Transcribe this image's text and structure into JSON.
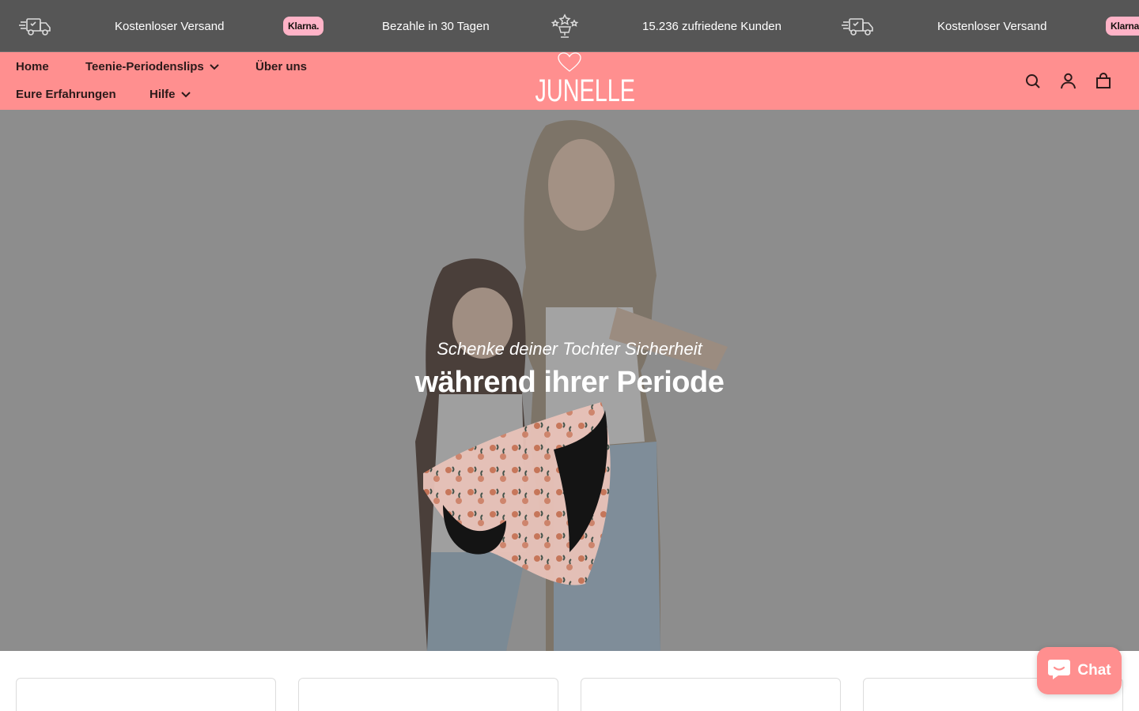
{
  "announcement": {
    "items": [
      {
        "icon": "truck-icon",
        "text": "Kostenloser Versand"
      },
      {
        "icon": "klarna-logo",
        "text": "Bezahle in 30 Tagen"
      },
      {
        "icon": "trophy-icon",
        "text": "15.236 zufriedene Kunden"
      },
      {
        "icon": "truck-icon",
        "text": "Kostenloser Versand"
      },
      {
        "icon": "klarna-logo"
      }
    ],
    "klarna_label": "Klarna.",
    "background": "#565656"
  },
  "header": {
    "background": "#ff8f8f",
    "logo_text": "JUNELLE",
    "nav": {
      "home": "Home",
      "teenie": "Teenie-Periodenslips",
      "about": "Über uns",
      "reviews": "Eure Erfahrungen",
      "help": "Hilfe"
    },
    "icons": [
      "search-icon",
      "account-icon",
      "cart-icon"
    ]
  },
  "hero": {
    "subtitle": "Schenke deiner Tochter Sicherheit",
    "title": "während ihrer Periode"
  },
  "chat": {
    "label": "Chat",
    "color": "#ff8f8f"
  }
}
